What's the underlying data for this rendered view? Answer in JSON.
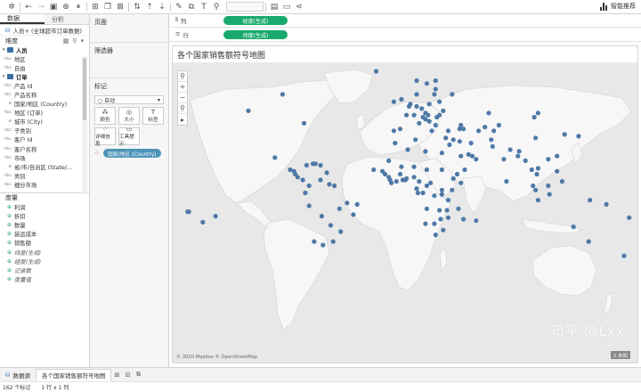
{
  "toolbar": {
    "smart_label": "智能推荐"
  },
  "datapane": {
    "tab_data": "数据",
    "tab_analysis": "分析",
    "datasource": "人员+ (全球超市订单数据)",
    "dimensions_header": "维度",
    "dimensions": [
      {
        "kind": "folder",
        "label": "人员"
      },
      {
        "kind": "Abc",
        "label": "地区"
      },
      {
        "kind": "Abc",
        "label": "自由"
      },
      {
        "kind": "folder",
        "label": "订单"
      },
      {
        "kind": "Abc",
        "label": "产品 Id"
      },
      {
        "kind": "Abc",
        "label": "产品名称"
      },
      {
        "kind": "geo",
        "label": "国家/地区 (Country)"
      },
      {
        "kind": "Abc",
        "label": "地区 (订单)"
      },
      {
        "kind": "geo",
        "label": "城市 (City)"
      },
      {
        "kind": "Abc",
        "label": "子类别"
      },
      {
        "kind": "Abc",
        "label": "客户 Id"
      },
      {
        "kind": "Abc",
        "label": "客户名称"
      },
      {
        "kind": "Abc",
        "label": "市场"
      },
      {
        "kind": "geo",
        "label": "省/市/自治区 (State/..."
      },
      {
        "kind": "Abc",
        "label": "类别"
      },
      {
        "kind": "Abc",
        "label": "细分市场"
      }
    ],
    "measures_header": "度量",
    "measures": [
      {
        "label": "利润",
        "italic": false
      },
      {
        "label": "折扣",
        "italic": false
      },
      {
        "label": "数量",
        "italic": false
      },
      {
        "label": "装运成本",
        "italic": false
      },
      {
        "label": "销售额",
        "italic": false
      },
      {
        "label": "纬度(生成)",
        "italic": true
      },
      {
        "label": "经度(生成)",
        "italic": true
      },
      {
        "label": "记录数",
        "italic": true
      },
      {
        "label": "度量值",
        "italic": true
      }
    ]
  },
  "shelves": {
    "pages": "页面",
    "filters": "筛选器",
    "marks": "标记",
    "marks_type": "自动",
    "color": "颜色",
    "size": "大小",
    "label": "标签",
    "detail": "详细信息",
    "tooltip": "工具提示",
    "detail_pill": "国家/地区 (Country)",
    "columns_label": "列",
    "rows_label": "行",
    "columns_pill": "经度(生成)",
    "rows_pill": "纬度(生成)"
  },
  "sheet": {
    "title": "各个国家销售额符号地图",
    "attribution": "© 2020 Mapbox © OpenStreetMap",
    "badge": "2 未知",
    "watermark": "知乎 @Lxx"
  },
  "sheetbar": {
    "datasource_tab": "数据源",
    "active_tab": "各个国家销售额符号地图"
  },
  "statusbar": {
    "marks": "162 个标记",
    "rows_cols": "1 行 x 1 列"
  },
  "colors": {
    "point": "#4e79a7",
    "pill_green": "#19a96d",
    "pill_blue": "#4d93b8",
    "land": "#f7f7f7",
    "water": "#e8e8e8"
  },
  "points": [
    [
      -123,
      49
    ],
    [
      -79,
      43
    ],
    [
      -96,
      56
    ],
    [
      -102,
      23
    ],
    [
      -90,
      15
    ],
    [
      -87,
      14
    ],
    [
      -86,
      12
    ],
    [
      -84,
      10
    ],
    [
      -80,
      8
    ],
    [
      -77,
      18
    ],
    [
      -72,
      19
    ],
    [
      -70,
      19
    ],
    [
      -66,
      18
    ],
    [
      -61,
      13
    ],
    [
      -75,
      4
    ],
    [
      -66,
      8
    ],
    [
      -78,
      -1
    ],
    [
      -75,
      -10
    ],
    [
      -65,
      -17
    ],
    [
      -58,
      -23
    ],
    [
      -56,
      -33
    ],
    [
      -64,
      -35
    ],
    [
      -71,
      -33
    ],
    [
      -59,
      5
    ],
    [
      -55,
      4
    ],
    [
      -51,
      -12
    ],
    [
      -45,
      -8
    ],
    [
      -40,
      -16
    ],
    [
      -50,
      -27
    ],
    [
      -37,
      -9
    ],
    [
      -22,
      64
    ],
    [
      -8,
      53
    ],
    [
      -2,
      54
    ],
    [
      -3,
      40
    ],
    [
      -8,
      39
    ],
    [
      2,
      47
    ],
    [
      4,
      51
    ],
    [
      5,
      52
    ],
    [
      10,
      51
    ],
    [
      8,
      47
    ],
    [
      14,
      50
    ],
    [
      17,
      48
    ],
    [
      19,
      47
    ],
    [
      20,
      52
    ],
    [
      12,
      43
    ],
    [
      25,
      61
    ],
    [
      18,
      60
    ],
    [
      10,
      61
    ],
    [
      10,
      56
    ],
    [
      26,
      46
    ],
    [
      25,
      42
    ],
    [
      22,
      39
    ],
    [
      33,
      35
    ],
    [
      20,
      44
    ],
    [
      17,
      45
    ],
    [
      15,
      46
    ],
    [
      24,
      56
    ],
    [
      25,
      58
    ],
    [
      28,
      53
    ],
    [
      31,
      49
    ],
    [
      28,
      47
    ],
    [
      45,
      42
    ],
    [
      44,
      40
    ],
    [
      47,
      40
    ],
    [
      38,
      56
    ],
    [
      35,
      39
    ],
    [
      39,
      34
    ],
    [
      36,
      31
    ],
    [
      44,
      33
    ],
    [
      45,
      24
    ],
    [
      51,
      25
    ],
    [
      54,
      24
    ],
    [
      57,
      22
    ],
    [
      48,
      15
    ],
    [
      53,
      32
    ],
    [
      67,
      48
    ],
    [
      64,
      41
    ],
    [
      59,
      39
    ],
    [
      71,
      39
    ],
    [
      75,
      42
    ],
    [
      69,
      34
    ],
    [
      70,
      30
    ],
    [
      79,
      22
    ],
    [
      81,
      7
    ],
    [
      84,
      28
    ],
    [
      90,
      24
    ],
    [
      91,
      27
    ],
    [
      96,
      21
    ],
    [
      101,
      15
    ],
    [
      105,
      12
    ],
    [
      106,
      16
    ],
    [
      102,
      4
    ],
    [
      104,
      1
    ],
    [
      114,
      4
    ],
    [
      106,
      -6
    ],
    [
      115,
      -2
    ],
    [
      121,
      14
    ],
    [
      125,
      7
    ],
    [
      114,
      22
    ],
    [
      121,
      24
    ],
    [
      127,
      37
    ],
    [
      138,
      36
    ],
    [
      104,
      35
    ],
    [
      103,
      46
    ],
    [
      106,
      48
    ],
    [
      -7,
      32
    ],
    [
      3,
      28
    ],
    [
      9,
      34
    ],
    [
      17,
      27
    ],
    [
      30,
      26
    ],
    [
      -12,
      21
    ],
    [
      -2,
      17
    ],
    [
      8,
      17
    ],
    [
      18,
      15
    ],
    [
      30,
      15
    ],
    [
      39,
      9
    ],
    [
      45,
      6
    ],
    [
      -17,
      14
    ],
    [
      -15,
      12
    ],
    [
      -12,
      10
    ],
    [
      -11,
      8
    ],
    [
      -6,
      7
    ],
    [
      -1,
      8
    ],
    [
      1,
      8
    ],
    [
      2,
      9
    ],
    [
      8,
      10
    ],
    [
      12,
      7
    ],
    [
      10,
      2
    ],
    [
      11,
      -1
    ],
    [
      15,
      -1
    ],
    [
      21,
      6
    ],
    [
      24,
      -3
    ],
    [
      30,
      -2
    ],
    [
      30,
      1
    ],
    [
      38,
      1
    ],
    [
      35,
      -6
    ],
    [
      42,
      12
    ],
    [
      28,
      -13
    ],
    [
      34,
      -13
    ],
    [
      35,
      -18
    ],
    [
      18,
      -12
    ],
    [
      29,
      -19
    ],
    [
      24,
      -22
    ],
    [
      17,
      -22
    ],
    [
      25,
      -29
    ],
    [
      31,
      -26
    ],
    [
      47,
      -19
    ],
    [
      57,
      -20
    ],
    [
      134,
      -24
    ],
    [
      146,
      -33
    ],
    [
      174,
      -41
    ],
    [
      147,
      -6
    ],
    [
      160,
      -9
    ],
    [
      178,
      -18
    ],
    [
      -171,
      -14
    ],
    [
      -170,
      -14
    ],
    [
      -159,
      -21
    ],
    [
      -149,
      -17
    ],
    [
      43,
      -12
    ],
    [
      18,
      4
    ],
    [
      -24,
      15
    ],
    [
      -10,
      6
    ],
    [
      -3,
      12
    ]
  ]
}
